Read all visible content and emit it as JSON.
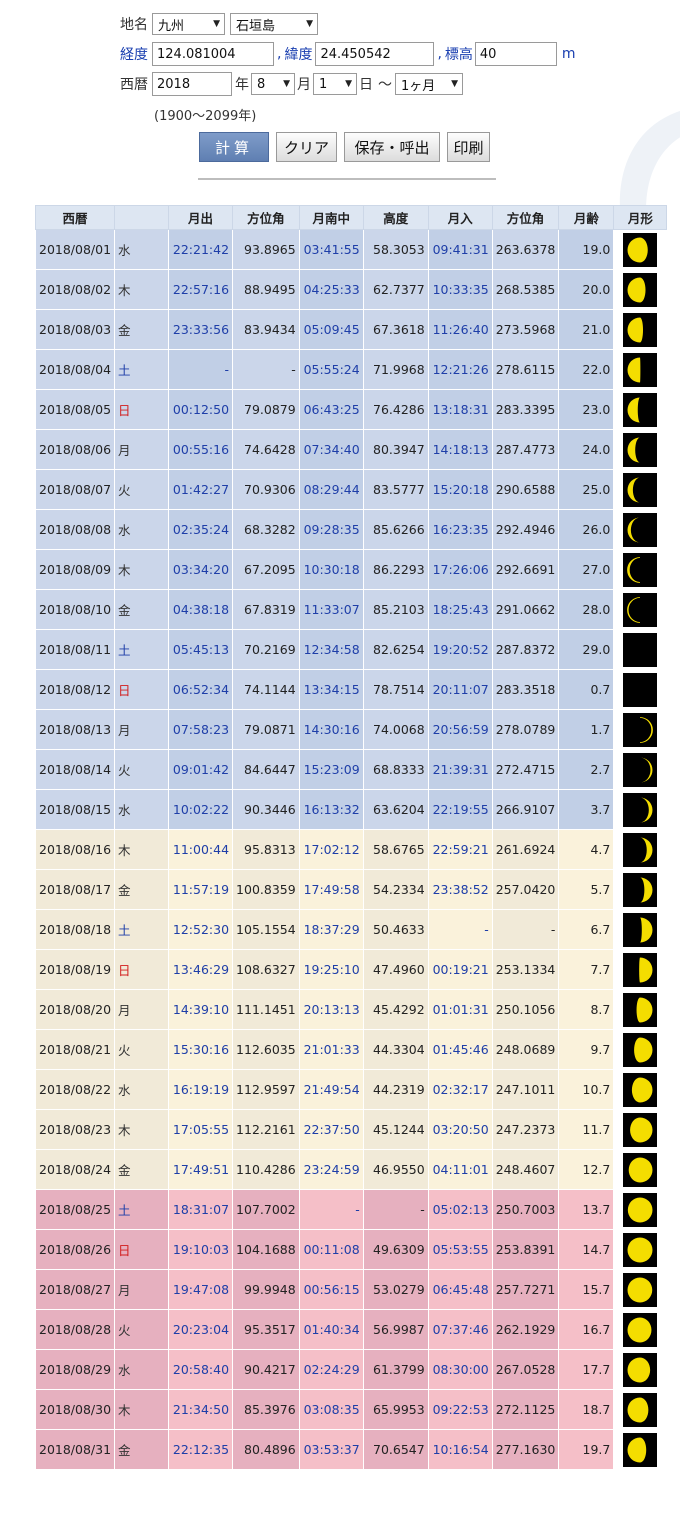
{
  "form": {
    "place_label": "地名",
    "region": "九州",
    "city": "石垣島",
    "lon_label": "経度",
    "lon": "124.081004",
    "lat_label": "緯度",
    "lat": "24.450542",
    "alt_label": "標高",
    "alt": "40",
    "alt_unit": "m",
    "sep": ",",
    "era_label": "西暦",
    "year": "2018",
    "year_unit": "年",
    "month": "8",
    "month_unit": "月",
    "day": "1",
    "day_unit": "日",
    "tilde": "～",
    "span": "1ヶ月",
    "range_note": "(1900～2099年)"
  },
  "buttons": {
    "calc": "計算",
    "clear": "クリア",
    "save": "保存・呼出",
    "print": "印刷"
  },
  "headers": [
    "西暦",
    "",
    "月出",
    "方位角",
    "月南中",
    "高度",
    "月入",
    "方位角",
    "月齢",
    "月形"
  ],
  "rows": [
    {
      "date": "2018/08/01",
      "wd": "水",
      "rise": "22:21:42",
      "az1": "93.8965",
      "transit": "03:41:55",
      "alt": "58.3053",
      "set": "09:41:31",
      "az2": "263.6378",
      "age": "19.0"
    },
    {
      "date": "2018/08/02",
      "wd": "木",
      "rise": "22:57:16",
      "az1": "88.9495",
      "transit": "04:25:33",
      "alt": "62.7377",
      "set": "10:33:35",
      "az2": "268.5385",
      "age": "20.0"
    },
    {
      "date": "2018/08/03",
      "wd": "金",
      "rise": "23:33:56",
      "az1": "83.9434",
      "transit": "05:09:45",
      "alt": "67.3618",
      "set": "11:26:40",
      "az2": "273.5968",
      "age": "21.0"
    },
    {
      "date": "2018/08/04",
      "wd": "土",
      "rise": "-",
      "az1": "-",
      "transit": "05:55:24",
      "alt": "71.9968",
      "set": "12:21:26",
      "az2": "278.6115",
      "age": "22.0"
    },
    {
      "date": "2018/08/05",
      "wd": "日",
      "rise": "00:12:50",
      "az1": "79.0879",
      "transit": "06:43:25",
      "alt": "76.4286",
      "set": "13:18:31",
      "az2": "283.3395",
      "age": "23.0"
    },
    {
      "date": "2018/08/06",
      "wd": "月",
      "rise": "00:55:16",
      "az1": "74.6428",
      "transit": "07:34:40",
      "alt": "80.3947",
      "set": "14:18:13",
      "az2": "287.4773",
      "age": "24.0"
    },
    {
      "date": "2018/08/07",
      "wd": "火",
      "rise": "01:42:27",
      "az1": "70.9306",
      "transit": "08:29:44",
      "alt": "83.5777",
      "set": "15:20:18",
      "az2": "290.6588",
      "age": "25.0"
    },
    {
      "date": "2018/08/08",
      "wd": "水",
      "rise": "02:35:24",
      "az1": "68.3282",
      "transit": "09:28:35",
      "alt": "85.6266",
      "set": "16:23:35",
      "az2": "292.4946",
      "age": "26.0"
    },
    {
      "date": "2018/08/09",
      "wd": "木",
      "rise": "03:34:20",
      "az1": "67.2095",
      "transit": "10:30:18",
      "alt": "86.2293",
      "set": "17:26:06",
      "az2": "292.6691",
      "age": "27.0"
    },
    {
      "date": "2018/08/10",
      "wd": "金",
      "rise": "04:38:18",
      "az1": "67.8319",
      "transit": "11:33:07",
      "alt": "85.2103",
      "set": "18:25:43",
      "az2": "291.0662",
      "age": "28.0"
    },
    {
      "date": "2018/08/11",
      "wd": "土",
      "rise": "05:45:13",
      "az1": "70.2169",
      "transit": "12:34:58",
      "alt": "82.6254",
      "set": "19:20:52",
      "az2": "287.8372",
      "age": "29.0"
    },
    {
      "date": "2018/08/12",
      "wd": "日",
      "rise": "06:52:34",
      "az1": "74.1144",
      "transit": "13:34:15",
      "alt": "78.7514",
      "set": "20:11:07",
      "az2": "283.3518",
      "age": "0.7"
    },
    {
      "date": "2018/08/13",
      "wd": "月",
      "rise": "07:58:23",
      "az1": "79.0871",
      "transit": "14:30:16",
      "alt": "74.0068",
      "set": "20:56:59",
      "az2": "278.0789",
      "age": "1.7"
    },
    {
      "date": "2018/08/14",
      "wd": "火",
      "rise": "09:01:42",
      "az1": "84.6447",
      "transit": "15:23:09",
      "alt": "68.8333",
      "set": "21:39:31",
      "az2": "272.4715",
      "age": "2.7"
    },
    {
      "date": "2018/08/15",
      "wd": "水",
      "rise": "10:02:22",
      "az1": "90.3446",
      "transit": "16:13:32",
      "alt": "63.6204",
      "set": "22:19:55",
      "az2": "266.9107",
      "age": "3.7"
    },
    {
      "date": "2018/08/16",
      "wd": "木",
      "rise": "11:00:44",
      "az1": "95.8313",
      "transit": "17:02:12",
      "alt": "58.6765",
      "set": "22:59:21",
      "az2": "261.6924",
      "age": "4.7"
    },
    {
      "date": "2018/08/17",
      "wd": "金",
      "rise": "11:57:19",
      "az1": "100.8359",
      "transit": "17:49:58",
      "alt": "54.2334",
      "set": "23:38:52",
      "az2": "257.0420",
      "age": "5.7"
    },
    {
      "date": "2018/08/18",
      "wd": "土",
      "rise": "12:52:30",
      "az1": "105.1554",
      "transit": "18:37:29",
      "alt": "50.4633",
      "set": "-",
      "az2": "-",
      "age": "6.7"
    },
    {
      "date": "2018/08/19",
      "wd": "日",
      "rise": "13:46:29",
      "az1": "108.6327",
      "transit": "19:25:10",
      "alt": "47.4960",
      "set": "00:19:21",
      "az2": "253.1334",
      "age": "7.7"
    },
    {
      "date": "2018/08/20",
      "wd": "月",
      "rise": "14:39:10",
      "az1": "111.1451",
      "transit": "20:13:13",
      "alt": "45.4292",
      "set": "01:01:31",
      "az2": "250.1056",
      "age": "8.7"
    },
    {
      "date": "2018/08/21",
      "wd": "火",
      "rise": "15:30:16",
      "az1": "112.6035",
      "transit": "21:01:33",
      "alt": "44.3304",
      "set": "01:45:46",
      "az2": "248.0689",
      "age": "9.7"
    },
    {
      "date": "2018/08/22",
      "wd": "水",
      "rise": "16:19:19",
      "az1": "112.9597",
      "transit": "21:49:54",
      "alt": "44.2319",
      "set": "02:32:17",
      "az2": "247.1011",
      "age": "10.7"
    },
    {
      "date": "2018/08/23",
      "wd": "木",
      "rise": "17:05:55",
      "az1": "112.2161",
      "transit": "22:37:50",
      "alt": "45.1244",
      "set": "03:20:50",
      "az2": "247.2373",
      "age": "11.7"
    },
    {
      "date": "2018/08/24",
      "wd": "金",
      "rise": "17:49:51",
      "az1": "110.4286",
      "transit": "23:24:59",
      "alt": "46.9550",
      "set": "04:11:01",
      "az2": "248.4607",
      "age": "12.7"
    },
    {
      "date": "2018/08/25",
      "wd": "土",
      "rise": "18:31:07",
      "az1": "107.7002",
      "transit": "-",
      "alt": "-",
      "set": "05:02:13",
      "az2": "250.7003",
      "age": "13.7"
    },
    {
      "date": "2018/08/26",
      "wd": "日",
      "rise": "19:10:03",
      "az1": "104.1688",
      "transit": "00:11:08",
      "alt": "49.6309",
      "set": "05:53:55",
      "az2": "253.8391",
      "age": "14.7"
    },
    {
      "date": "2018/08/27",
      "wd": "月",
      "rise": "19:47:08",
      "az1": "99.9948",
      "transit": "00:56:15",
      "alt": "53.0279",
      "set": "06:45:48",
      "az2": "257.7271",
      "age": "15.7"
    },
    {
      "date": "2018/08/28",
      "wd": "火",
      "rise": "20:23:04",
      "az1": "95.3517",
      "transit": "01:40:34",
      "alt": "56.9987",
      "set": "07:37:46",
      "az2": "262.1929",
      "age": "16.7"
    },
    {
      "date": "2018/08/29",
      "wd": "水",
      "rise": "20:58:40",
      "az1": "90.4217",
      "transit": "02:24:29",
      "alt": "61.3799",
      "set": "08:30:00",
      "az2": "267.0528",
      "age": "17.7"
    },
    {
      "date": "2018/08/30",
      "wd": "木",
      "rise": "21:34:50",
      "az1": "85.3976",
      "transit": "03:08:35",
      "alt": "65.9953",
      "set": "09:22:53",
      "az2": "272.1125",
      "age": "18.7"
    },
    {
      "date": "2018/08/31",
      "wd": "金",
      "rise": "22:12:35",
      "az1": "80.4896",
      "transit": "03:53:37",
      "alt": "70.6547",
      "set": "10:16:54",
      "az2": "277.1630",
      "age": "19.7"
    }
  ],
  "colors": {
    "moon": "#f4dd00",
    "moon_bg": "#000000",
    "time_text": "#1e3ea8",
    "holiday": "#d21c1c"
  }
}
